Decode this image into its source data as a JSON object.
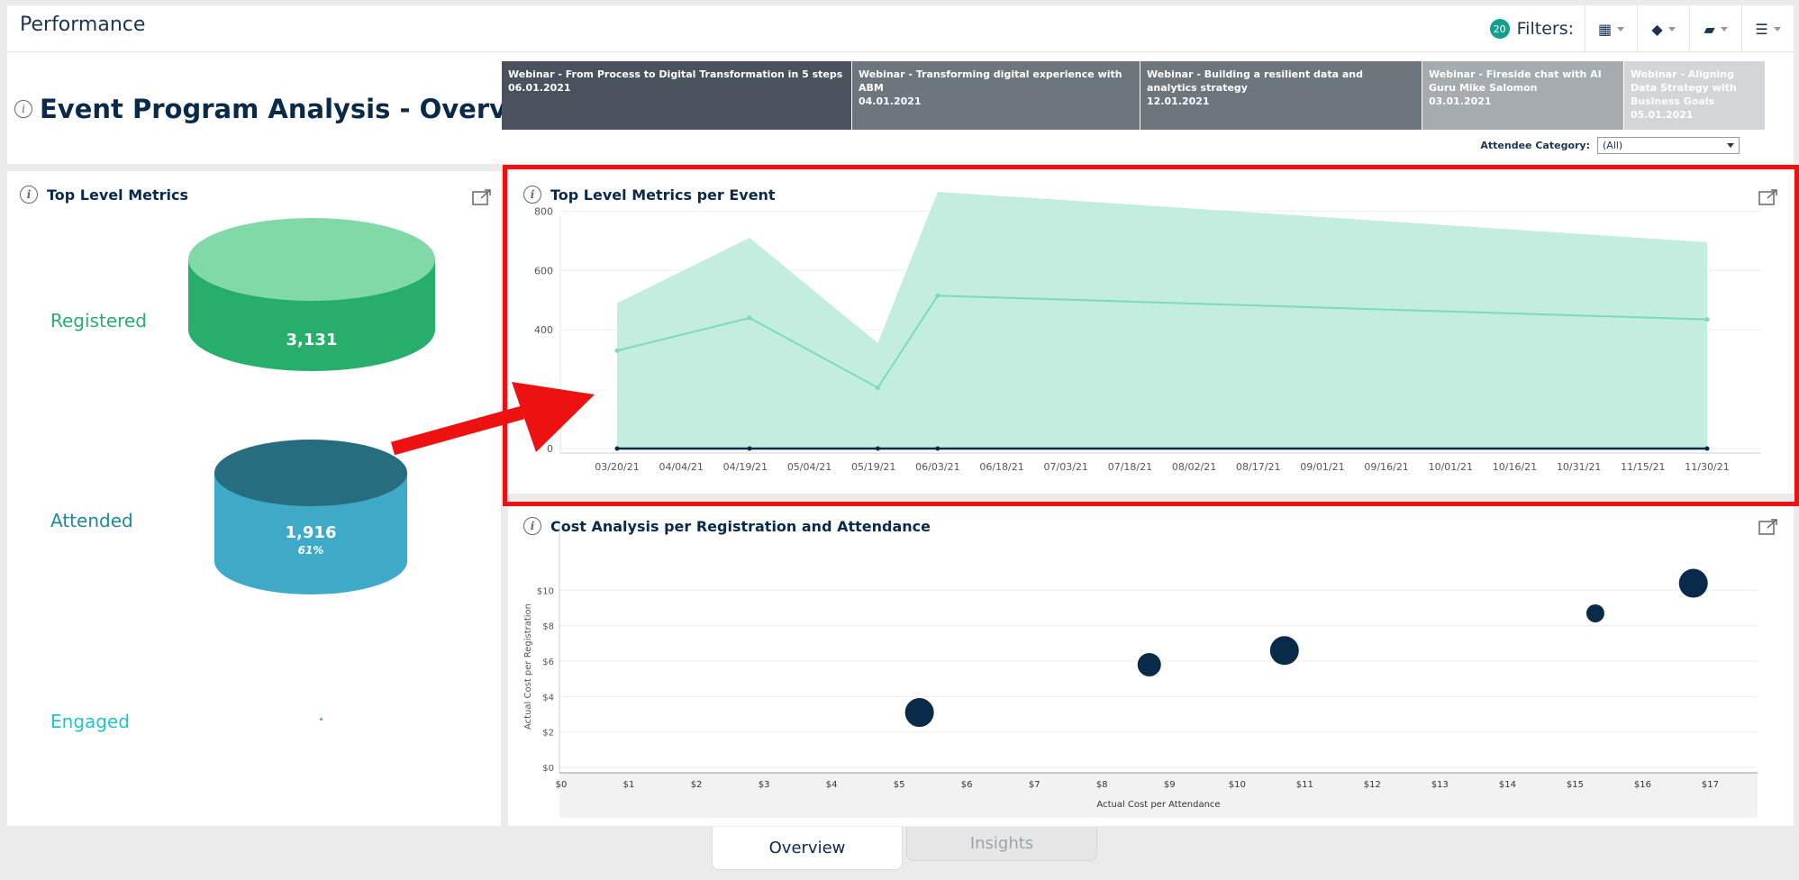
{
  "app": {
    "title": "Performance"
  },
  "filters": {
    "count": "20",
    "label": "Filters:",
    "tools": [
      {
        "icon": "calendar-icon",
        "glyph": "▦"
      },
      {
        "icon": "tag-icon",
        "glyph": "◆"
      },
      {
        "icon": "folder-icon",
        "glyph": "▰"
      },
      {
        "icon": "list-settings-icon",
        "glyph": "☰"
      }
    ]
  },
  "header": {
    "title": "Event Program Analysis - Overview",
    "attendee_category_label": "Attendee Category:",
    "attendee_category_value": "(All)"
  },
  "events": [
    {
      "name": "Webinar - From Process to Digital Transformation in 5 steps",
      "date": "06.01.2021",
      "color": "#49525d",
      "text_color": "#ffffff"
    },
    {
      "name": "Webinar - Transforming digital experience with ABM",
      "date": "04.01.2021",
      "color": "#6e767d",
      "text_color": "#ffffff"
    },
    {
      "name": "Webinar - Building a resilient data and analytics strategy",
      "date": "12.01.2021",
      "color": "#6e767d",
      "text_color": "#ffffff"
    },
    {
      "name": "Webinar - Fireside chat with AI Guru Mike Salomon",
      "date": "03.01.2021",
      "color": "#a6abaf",
      "text_color": "#ffffff"
    },
    {
      "name": "Webinar - Aligning Data Strategy with Business Goals",
      "date": "05.01.2021",
      "color": "#d3d5d7",
      "text_color": "#ffffff"
    }
  ],
  "top_metrics": {
    "title": "Top Level Metrics",
    "registered": {
      "label": "Registered",
      "value": "3,131",
      "color": "#27ae6b"
    },
    "attended": {
      "label": "Attended",
      "value": "1,916",
      "percent": "61%",
      "color": "#1f8a9a"
    },
    "engaged": {
      "label": "Engaged",
      "color": "#22c4c4"
    }
  },
  "metrics_per_event": {
    "title": "Top Level Metrics per Event",
    "chart_data": {
      "type": "area",
      "x_ticks": [
        "03/20/21",
        "04/04/21",
        "04/19/21",
        "05/04/21",
        "05/19/21",
        "06/03/21",
        "06/18/21",
        "07/03/21",
        "07/18/21",
        "08/02/21",
        "08/17/21",
        "09/01/21",
        "09/16/21",
        "10/01/21",
        "10/16/21",
        "10/31/21",
        "11/15/21",
        "11/30/21"
      ],
      "y_ticks": [
        0,
        400,
        600,
        800
      ],
      "ylim": [
        0,
        880
      ],
      "x": [
        "2021-03-20",
        "2021-04-20",
        "2021-05-20",
        "2021-06-03",
        "2021-11-30"
      ],
      "series": [
        {
          "values": [
            490,
            710,
            355,
            865,
            695
          ],
          "color": "#b8ead8",
          "kind": "area"
        },
        {
          "values": [
            330,
            440,
            205,
            515,
            435
          ],
          "color": "#7cdcb8",
          "kind": "line"
        },
        {
          "values": [
            0,
            0,
            0,
            0,
            0
          ],
          "color": "#0a2a4a",
          "kind": "line"
        }
      ]
    }
  },
  "cost_analysis": {
    "title": "Cost Analysis per Registration and Attendance",
    "chart_data": {
      "type": "scatter",
      "xlabel": "Actual Cost per Attendance",
      "ylabel": "Actual Cost per Registration",
      "x_ticks": [
        "$0",
        "$1",
        "$2",
        "$3",
        "$4",
        "$5",
        "$6",
        "$7",
        "$8",
        "$9",
        "$10",
        "$11",
        "$12",
        "$13",
        "$14",
        "$15",
        "$16",
        "$17"
      ],
      "y_ticks": [
        "$0",
        "$2",
        "$4",
        "$6",
        "$8",
        "$10"
      ],
      "xlim": [
        0,
        17.7
      ],
      "ylim": [
        0,
        11.7
      ],
      "points": [
        {
          "x": 5.3,
          "y": 3.1,
          "size": "large"
        },
        {
          "x": 8.7,
          "y": 5.8,
          "size": "medium"
        },
        {
          "x": 10.7,
          "y": 6.6,
          "size": "large"
        },
        {
          "x": 15.3,
          "y": 8.7,
          "size": "small"
        },
        {
          "x": 16.75,
          "y": 10.4,
          "size": "large"
        }
      ],
      "color": "#0a2a4a"
    }
  },
  "bottom_tabs": {
    "overview": "Overview",
    "insights": "Insights"
  }
}
